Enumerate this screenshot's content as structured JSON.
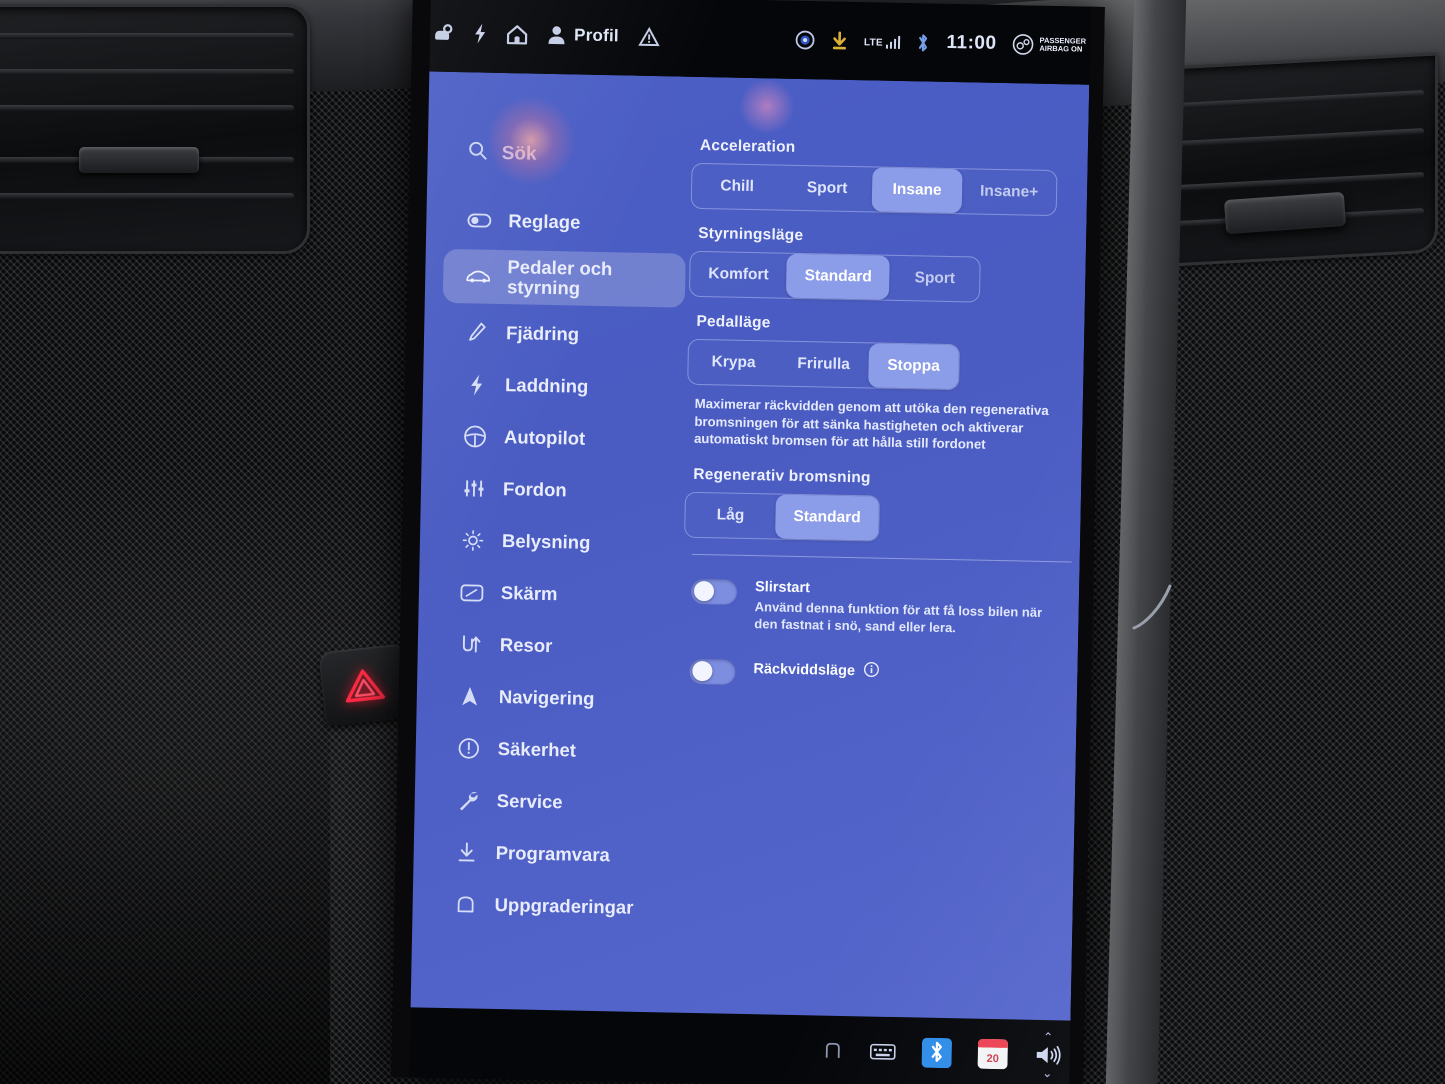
{
  "status_bar": {
    "left_icons": [
      "car-lock-icon",
      "charge-bolt-icon",
      "home-icon"
    ],
    "profile_label": "Profil",
    "warning_icon": "warning-triangle-icon",
    "right_icons": [
      "camera-dot-icon",
      "download-arrow-icon",
      "bluetooth-icon"
    ],
    "network_label": "LTE",
    "clock": "11:00",
    "airbag_line1": "PASSENGER",
    "airbag_line2": "AIRBAG",
    "airbag_state": "ON"
  },
  "sidebar": {
    "search_placeholder": "Sök",
    "items": [
      {
        "label": "Reglage",
        "icon": "toggle-switch-icon",
        "active": false
      },
      {
        "label": "Pedaler och styrning",
        "icon": "car-icon",
        "active": true
      },
      {
        "label": "Fjädring",
        "icon": "suspension-icon",
        "active": false
      },
      {
        "label": "Laddning",
        "icon": "bolt-icon",
        "active": false
      },
      {
        "label": "Autopilot",
        "icon": "steering-wheel-icon",
        "active": false
      },
      {
        "label": "Fordon",
        "icon": "sliders-icon",
        "active": false
      },
      {
        "label": "Belysning",
        "icon": "sun-icon",
        "active": false
      },
      {
        "label": "Skärm",
        "icon": "display-icon",
        "active": false
      },
      {
        "label": "Resor",
        "icon": "trips-icon",
        "active": false
      },
      {
        "label": "Navigering",
        "icon": "navigation-arrow-icon",
        "active": false
      },
      {
        "label": "Säkerhet",
        "icon": "alert-circle-icon",
        "active": false
      },
      {
        "label": "Service",
        "icon": "wrench-icon",
        "active": false
      },
      {
        "label": "Programvara",
        "icon": "download-icon",
        "active": false
      },
      {
        "label": "Uppgraderingar",
        "icon": "upgrade-icon",
        "active": false
      }
    ]
  },
  "content": {
    "acceleration": {
      "title": "Acceleration",
      "options": [
        "Chill",
        "Sport",
        "Insane",
        "Insane+"
      ],
      "selected": "Insane"
    },
    "steering_mode": {
      "title": "Styrningsläge",
      "options": [
        "Komfort",
        "Standard",
        "Sport"
      ],
      "selected": "Standard"
    },
    "pedal_mode": {
      "title": "Pedalläge",
      "options": [
        "Krypa",
        "Frirulla",
        "Stoppa"
      ],
      "selected": "Stoppa",
      "description": "Maximerar räckvidden genom att utöka den regenerativa bromsningen för att sänka hastigheten och aktiverar automatiskt bromsen för att hålla still fordonet"
    },
    "regen_braking": {
      "title": "Regenerativ bromsning",
      "options": [
        "Låg",
        "Standard"
      ],
      "selected": "Standard"
    },
    "toggles": [
      {
        "title": "Slirstart",
        "description": "Använd denna funktion för att få loss bilen när den fastnat i snö, sand eller lera.",
        "state": "off",
        "has_info": false
      },
      {
        "title": "Räckviddsläge",
        "description": "",
        "state": "off",
        "has_info": true
      }
    ]
  },
  "bottom_bar": {
    "icons": [
      "seat-heater-icon",
      "keyboard-icon",
      "bluetooth-tile-icon",
      "calendar-tile-icon"
    ],
    "calendar_day": "20",
    "volume_icon": "volume-icon",
    "chevron_up": "⌃",
    "chevron_down": "⌄"
  },
  "interior": {
    "hazard_button": "hazard-triangle-button",
    "vents": [
      "air-vent-left",
      "air-vent-right"
    ]
  },
  "colors": {
    "panel_blue": "#4b5ec5",
    "selected_blue": "#8b9ce8",
    "status_bar": "#05060a",
    "hazard_red": "#e8243c"
  }
}
